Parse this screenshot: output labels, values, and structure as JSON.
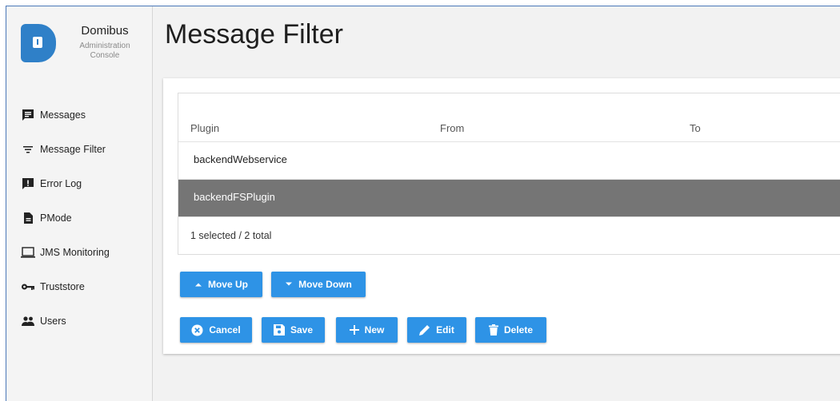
{
  "brand": {
    "title": "Domibus",
    "subtitle_line1": "Administration",
    "subtitle_line2": "Console",
    "accent": "#2f80c8"
  },
  "sidebar": {
    "items": [
      {
        "label": "Messages",
        "icon": "message-icon"
      },
      {
        "label": "Message Filter",
        "icon": "filter-icon"
      },
      {
        "label": "Error Log",
        "icon": "error-log-icon"
      },
      {
        "label": "PMode",
        "icon": "document-icon"
      },
      {
        "label": "JMS Monitoring",
        "icon": "monitor-icon"
      },
      {
        "label": "Truststore",
        "icon": "key-icon"
      },
      {
        "label": "Users",
        "icon": "users-icon"
      }
    ]
  },
  "page": {
    "title": "Message Filter"
  },
  "table": {
    "columns": [
      "Plugin",
      "From",
      "To"
    ],
    "rows": [
      {
        "plugin": "backendWebservice",
        "from": "",
        "to": "",
        "selected": false
      },
      {
        "plugin": "backendFSPlugin",
        "from": "",
        "to": "",
        "selected": true
      }
    ],
    "footer": "1 selected / 2 total",
    "selected_row_color": "#757575"
  },
  "buttons": {
    "move_up": "Move Up",
    "move_down": "Move Down",
    "cancel": "Cancel",
    "save": "Save",
    "new": "New",
    "edit": "Edit",
    "delete": "Delete",
    "color": "#2e93e6"
  }
}
